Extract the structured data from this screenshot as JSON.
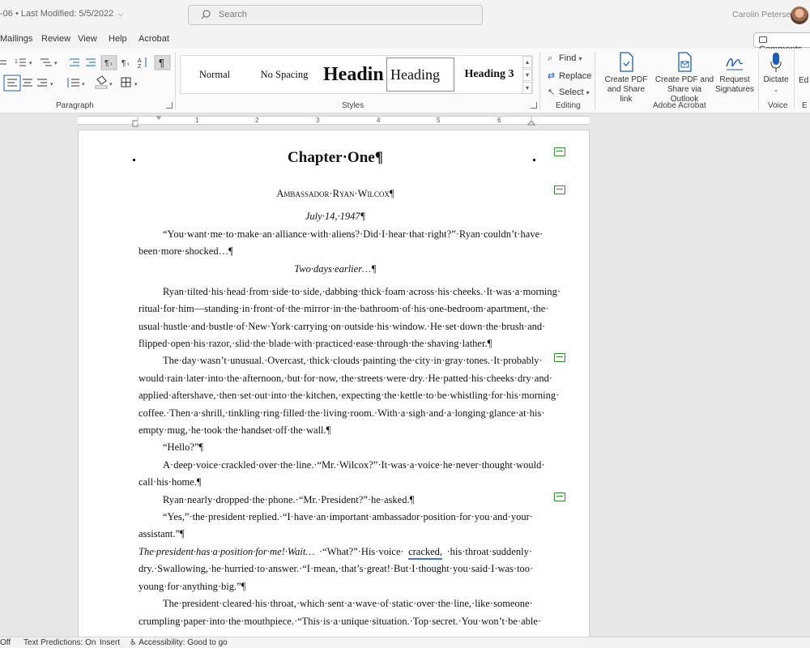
{
  "titlebar": {
    "doc_fragment": "-06",
    "modified": "Last Modified: 5/5/2022",
    "search_placeholder": "Search",
    "user_name": "Carolin Petersen"
  },
  "tabs": [
    "Mailings",
    "Review",
    "View",
    "Help",
    "Acrobat"
  ],
  "comments_label": "Comments",
  "ribbon": {
    "paragraph_label": "Paragraph",
    "styles_label": "Styles",
    "editing_label": "Editing",
    "acrobat_label": "Adobe Acrobat",
    "voice_label": "Voice",
    "styles": [
      "Normal",
      "No Spacing",
      "Headin",
      "Heading",
      "Heading 3"
    ],
    "find": "Find",
    "replace": "Replace",
    "select": "Select",
    "create_pdf": [
      "Create PDF",
      "and Share link"
    ],
    "create_pdf_outlook": [
      "Create PDF and",
      "Share via Outlook"
    ],
    "request_sig": [
      "Request",
      "Signatures"
    ],
    "dictate": "Dictate",
    "edge_label": "Ed"
  },
  "ruler_numbers": [
    "1",
    "2",
    "3",
    "4",
    "5",
    "6"
  ],
  "document": {
    "chapter": "Chapter·One¶",
    "author": "Ambassador·Ryan·Wilcox¶",
    "date": "July·14,·1947¶",
    "lines": [
      "“You·want·me·to·make·an·alliance·with·aliens?·Did·I·hear·that·right?”·Ryan·couldn’t·have·",
      "been·more·shocked…¶",
      "Two·days·earlier…¶",
      "Ryan·tilted·his·head·from·side·to·side,·dabbing·thick·foam·across·his·cheeks.·It·was·a·morning·",
      "ritual·for·him—standing·in·front·of·the·mirror·in·the·bathroom·of·his·one-bedroom·apartment,·the·",
      "usual·hustle·and·bustle·of·New·York·carrying·on·outside·his·window.·He·set·down·the·brush·and·",
      "flipped·open·his·razor,·slid·the·blade·with·practiced·ease·through·the·shaving·lather.¶",
      "The·day·wasn’t·unusual.·Overcast,·thick·clouds·painting·the·city·in·gray·tones.·It·probably·",
      "would·rain·later·into·the·afternoon,·but·for·now,·the·streets·were·dry.·He·patted·his·cheeks·dry·and·",
      "applied·aftershave,·then·set·out·into·the·kitchen,·expecting·the·kettle·to·be·whistling·for·his·morning·",
      "coffee.·Then·a·shrill,·tinkling·ring·filled·the·living·room.·With·a·sigh·and·a·longing·glance·at·his·",
      "empty·mug,·he·took·the·handset·off·the·wall.¶",
      "“Hello?”¶",
      "A·deep·voice·crackled·over·the·line.·“Mr.·Wilcox?”·It·was·a·voice·he·never·thought·would·",
      "call·his·home.¶",
      "Ryan·nearly·dropped·the·phone.·“Mr.·President?”·he·asked.¶",
      "“Yes,”·the·president·replied.·“I·have·an·important·ambassador·position·for·you·and·your·",
      "assistant.”¶",
      "The·president·has·a·position·for·me!·Wait…",
      "·“What?”·His·voice·",
      "cracked,",
      "·his·throat·suddenly·",
      "dry.·Swallowing,·he·hurried·to·answer.·“I·mean,·that’s·great!·But·I·thought·you·said·I·was·too·",
      "young·for·anything·big.”¶",
      "The·president·cleared·his·throat,·which·sent·a·wave·of·static·over·the·line,·like·someone·",
      "crumpling·paper·into·the·mouthpiece.·“This·is·a·unique·situation.·Top·secret.·You·won’t·be·able·"
    ]
  },
  "status": {
    "off": "Off",
    "text_predictions": "Text Predictions: On",
    "insert": "Insert",
    "accessibility": "Accessibility: Good to go"
  }
}
